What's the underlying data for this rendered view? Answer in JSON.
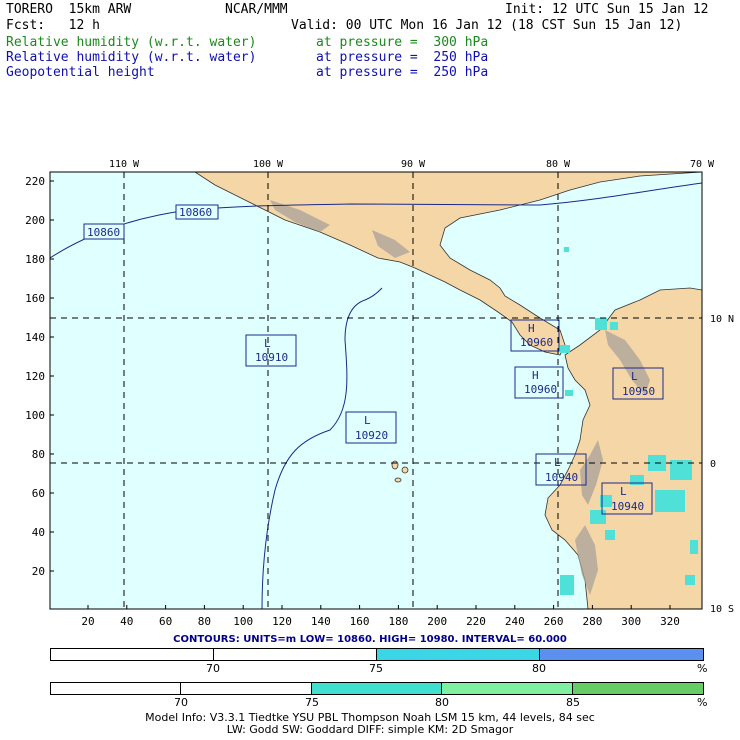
{
  "header": {
    "model": "TORERO  15km ARW",
    "org": "NCAR/MMM",
    "init": "Init: 12 UTC Sun 15 Jan 12",
    "fcst": "Fcst:   12 h",
    "valid": "Valid: 00 UTC Mon 16 Jan 12 (18 CST Sun 15 Jan 12)",
    "fields": [
      {
        "name": "Relative humidity (w.r.t. water)",
        "level": "at pressure =  300 hPa",
        "color": "#1b8a1b"
      },
      {
        "name": "Relative humidity (w.r.t. water)",
        "level": "at pressure =  250 hPa",
        "color": "#1010b0"
      },
      {
        "name": "Geopotential height",
        "level": "at pressure =  250 hPa",
        "color": "#1010b0"
      }
    ]
  },
  "map": {
    "top_lon_labels": [
      "110 W",
      "100 W",
      "90 W",
      "80 W",
      "70 W"
    ],
    "right_lat_labels": [
      "10 N",
      "0",
      "10 S"
    ],
    "left_ticks": [
      "220",
      "200",
      "180",
      "160",
      "140",
      "120",
      "100",
      "80",
      "60",
      "40",
      "20"
    ],
    "bottom_ticks": [
      "20",
      "40",
      "60",
      "80",
      "100",
      "120",
      "140",
      "160",
      "180",
      "200",
      "220",
      "240",
      "260",
      "280",
      "300",
      "320"
    ],
    "contour_labels": [
      "10860",
      "10860"
    ],
    "pressure_centers": [
      {
        "type": "H",
        "value": "10960"
      },
      {
        "type": "H",
        "value": "10960"
      },
      {
        "type": "L",
        "value": "10910"
      },
      {
        "type": "L",
        "value": "10920"
      },
      {
        "type": "L",
        "value": "10950"
      },
      {
        "type": "L",
        "value": "10940"
      },
      {
        "type": "L",
        "value": "10940"
      }
    ],
    "colors": {
      "ocean": "#e0ffff",
      "land": "#f5d6a6",
      "contour": "#1a2a8a",
      "humid": "#4fe0d8"
    }
  },
  "contours_info": "CONTOURS:  UNITS=m  LOW=  10860.     HIGH=  10980.     INTERVAL=   60.000",
  "scale_300": {
    "ticks": [
      "70",
      "75",
      "80",
      "%"
    ],
    "colors": [
      "#ffffff",
      "#ffffff",
      "#3ad6e6",
      "#5b8ff0"
    ]
  },
  "scale_250": {
    "ticks": [
      "70",
      "75",
      "80",
      "85",
      "%"
    ],
    "colors": [
      "#ffffff",
      "#ffffff",
      "#40e0d0",
      "#7ff0a0",
      "#66cc66"
    ]
  },
  "footer": {
    "line1": "Model Info: V3.3.1   Tiedtke YSU PBL  Thompson   Noah LSM  15 km,   44 levels,   84 sec",
    "line2": "LW: Godd SW: Goddard DIFF: simple KM: 2D Smagor"
  }
}
